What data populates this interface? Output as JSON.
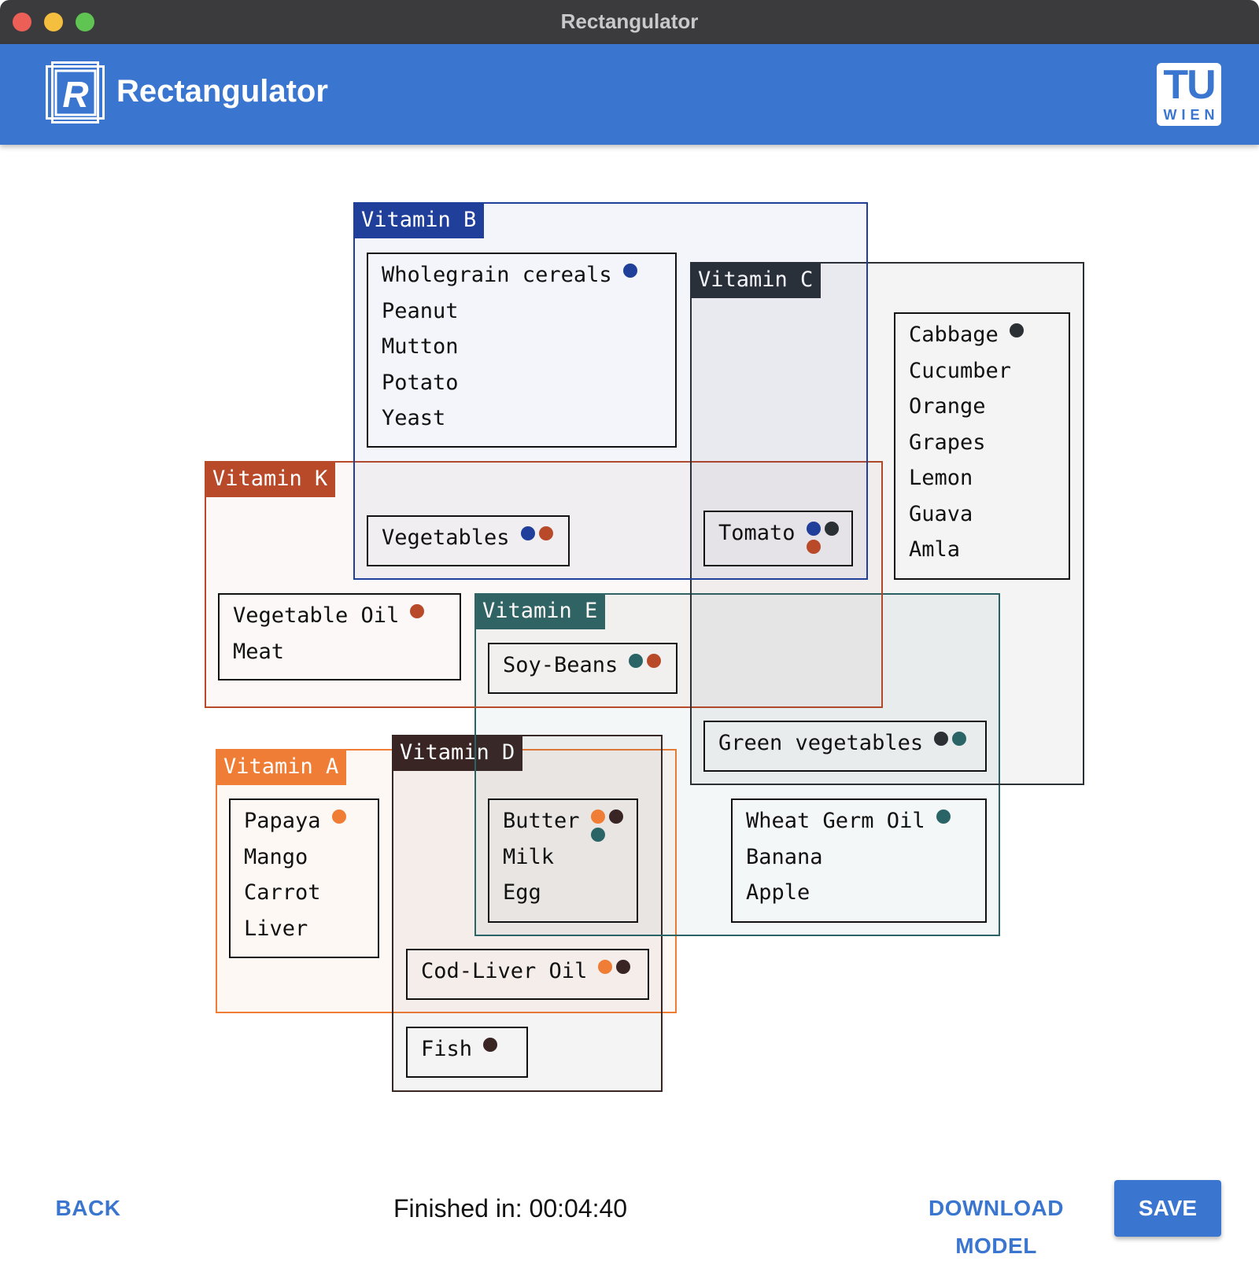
{
  "window": {
    "title": "Rectangulator"
  },
  "header": {
    "app_title": "Rectangulator",
    "logo_letter": "R",
    "tu_logo_main": "TU",
    "tu_logo_sub": "WIEN"
  },
  "colors": {
    "accent": "#3a76cf",
    "vitamin_b": "#1f3f9a",
    "vitamin_c": "#2b3035",
    "vitamin_k": "#b84a2a",
    "vitamin_e": "#2a6467",
    "vitamin_a": "#ef7d35",
    "vitamin_d": "#3a2525"
  },
  "sets": [
    {
      "id": "vitamin-b",
      "label": "Vitamin B",
      "color": "#1f3f9a"
    },
    {
      "id": "vitamin-c",
      "label": "Vitamin C",
      "color": "#2b3035"
    },
    {
      "id": "vitamin-k",
      "label": "Vitamin K",
      "color": "#b84a2a"
    },
    {
      "id": "vitamin-e",
      "label": "Vitamin E",
      "color": "#2a6467"
    },
    {
      "id": "vitamin-a",
      "label": "Vitamin A",
      "color": "#ef7d35"
    },
    {
      "id": "vitamin-d",
      "label": "Vitamin D",
      "color": "#3a2525"
    }
  ],
  "groups": [
    {
      "id": "vitamin-b-only",
      "items": [
        "Wholegrain cereals",
        "Peanut",
        "Mutton",
        "Potato",
        "Yeast"
      ],
      "sets": [
        "vitamin-b"
      ]
    },
    {
      "id": "vitamin-c-only",
      "items": [
        "Cabbage",
        "Cucumber",
        "Orange",
        "Grapes",
        "Lemon",
        "Guava",
        "Amla"
      ],
      "sets": [
        "vitamin-c"
      ]
    },
    {
      "id": "vegetables",
      "items": [
        "Vegetables"
      ],
      "sets": [
        "vitamin-b",
        "vitamin-k"
      ]
    },
    {
      "id": "tomato",
      "items": [
        "Tomato"
      ],
      "sets": [
        "vitamin-b",
        "vitamin-c",
        "vitamin-k"
      ]
    },
    {
      "id": "vitamin-k-only",
      "items": [
        "Vegetable Oil",
        "Meat"
      ],
      "sets": [
        "vitamin-k"
      ]
    },
    {
      "id": "soy-beans",
      "items": [
        "Soy-Beans"
      ],
      "sets": [
        "vitamin-e",
        "vitamin-k"
      ]
    },
    {
      "id": "green-vegetables",
      "items": [
        "Green vegetables"
      ],
      "sets": [
        "vitamin-c",
        "vitamin-e"
      ]
    },
    {
      "id": "vitamin-a-only",
      "items": [
        "Papaya",
        "Mango",
        "Carrot",
        "Liver"
      ],
      "sets": [
        "vitamin-a"
      ]
    },
    {
      "id": "butter-milk-egg",
      "items": [
        "Butter",
        "Milk",
        "Egg"
      ],
      "sets": [
        "vitamin-a",
        "vitamin-d",
        "vitamin-e"
      ]
    },
    {
      "id": "vitamin-e-only",
      "items": [
        "Wheat Germ Oil",
        "Banana",
        "Apple"
      ],
      "sets": [
        "vitamin-e"
      ]
    },
    {
      "id": "cod-liver-oil",
      "items": [
        "Cod-Liver Oil"
      ],
      "sets": [
        "vitamin-a",
        "vitamin-d"
      ]
    },
    {
      "id": "fish",
      "items": [
        "Fish"
      ],
      "sets": [
        "vitamin-d"
      ]
    }
  ],
  "footer": {
    "back_label": "BACK",
    "timer_label": "Finished in:",
    "timer_value": "00:04:40",
    "download_label": "DOWNLOAD MODEL",
    "save_label": "SAVE"
  }
}
